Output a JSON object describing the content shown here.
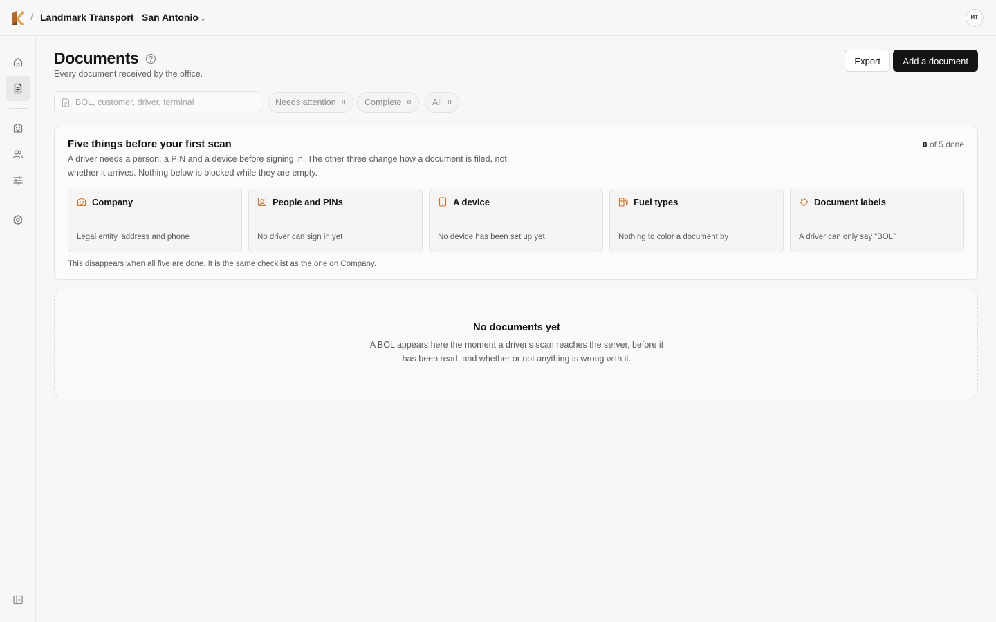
{
  "breadcrumb": {
    "company": "Landmark Transport",
    "separator": "/",
    "location": "San Antonio",
    "location_chevron": "⌄"
  },
  "user": {
    "initials": "MI"
  },
  "sidebar": {
    "items": [
      {
        "name": "home",
        "icon": "home-icon",
        "active": false
      },
      {
        "name": "documents",
        "icon": "document-icon",
        "active": true
      },
      {
        "name": "company",
        "icon": "building-icon",
        "active": false
      },
      {
        "name": "people",
        "icon": "users-icon",
        "active": false
      },
      {
        "name": "adjustments",
        "icon": "sliders-icon",
        "active": false
      },
      {
        "name": "settings",
        "icon": "gear-icon",
        "active": false
      }
    ],
    "collapse_icon": "sidebar-toggle-icon"
  },
  "page": {
    "title": "Documents",
    "subtitle": "Every document received by the office.",
    "export_label": "Export",
    "add_label": "Add a document"
  },
  "search": {
    "placeholder": "BOL, customer, driver, terminal",
    "value": ""
  },
  "filters": [
    {
      "label": "Needs attention",
      "count": "0"
    },
    {
      "label": "Complete",
      "count": "0"
    },
    {
      "label": "All",
      "count": "0"
    }
  ],
  "checklist": {
    "title": "Five things before your first scan",
    "description": "A driver needs a person, a PIN and a device before signing in. The other three change how a document is filed, not whether it arrives. Nothing below is blocked while they are empty.",
    "progress_done": "0",
    "progress_rest": " of 5 done",
    "steps": [
      {
        "title": "Company",
        "description": "Legal entity, address and phone",
        "icon": "building-icon"
      },
      {
        "title": "People and PINs",
        "description": "No driver can sign in yet",
        "icon": "person-badge-icon"
      },
      {
        "title": "A device",
        "description": "No device has been set up yet",
        "icon": "tablet-icon"
      },
      {
        "title": "Fuel types",
        "description": "Nothing to color a document by",
        "icon": "fuel-pump-icon"
      },
      {
        "title": "Document labels",
        "description": "A driver can only say “BOL”",
        "icon": "tag-icon"
      }
    ],
    "footer": "This disappears when all five are done. It is the same checklist as the one on Company."
  },
  "empty_state": {
    "title": "No documents yet",
    "description": "A BOL appears here the moment a driver's scan reaches the server, before it has been read, and whether or not anything is wrong with it."
  },
  "colors": {
    "accent": "#c8742a",
    "primary_button": "#141414",
    "background": "#f7f7f7",
    "border": "#e3e3e3"
  }
}
